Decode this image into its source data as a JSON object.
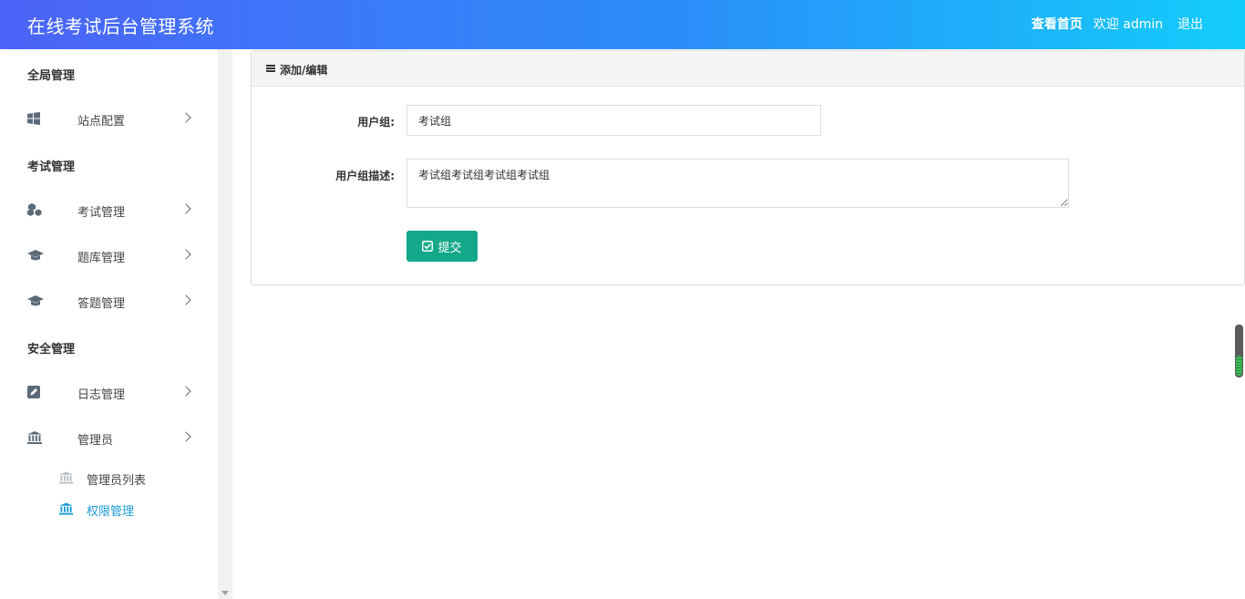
{
  "header": {
    "title": "在线考试后台管理系统",
    "home_link": "查看首页",
    "welcome": "欢迎 admin",
    "logout": "退出"
  },
  "sidebar": {
    "sections": [
      {
        "title": "全局管理",
        "items": [
          {
            "label": "站点配置",
            "icon": "windows-icon"
          }
        ]
      },
      {
        "title": "考试管理",
        "items": [
          {
            "label": "考试管理",
            "icon": "cubes-icon"
          },
          {
            "label": "题库管理",
            "icon": "graduation-cap-icon"
          },
          {
            "label": "答题管理",
            "icon": "graduation-cap-icon"
          }
        ]
      },
      {
        "title": "安全管理",
        "items": [
          {
            "label": "日志管理",
            "icon": "edit-icon"
          },
          {
            "label": "管理员",
            "icon": "bank-icon"
          }
        ]
      }
    ],
    "subitems": [
      {
        "label": "管理员列表",
        "icon": "bank-icon",
        "active": false
      },
      {
        "label": "权限管理",
        "icon": "bank-icon",
        "active": true
      }
    ]
  },
  "panel": {
    "title": "添加/编辑",
    "fields": {
      "group_label": "用户组:",
      "group_value": "考试组",
      "desc_label": "用户组描述:",
      "desc_value": "考试组考试组考试组考试组"
    },
    "submit_label": "提交"
  },
  "colors": {
    "header_start": "#4d63f7",
    "header_end": "#13cdfb",
    "submit": "#14a88a",
    "active_link": "#1a9ad6"
  }
}
